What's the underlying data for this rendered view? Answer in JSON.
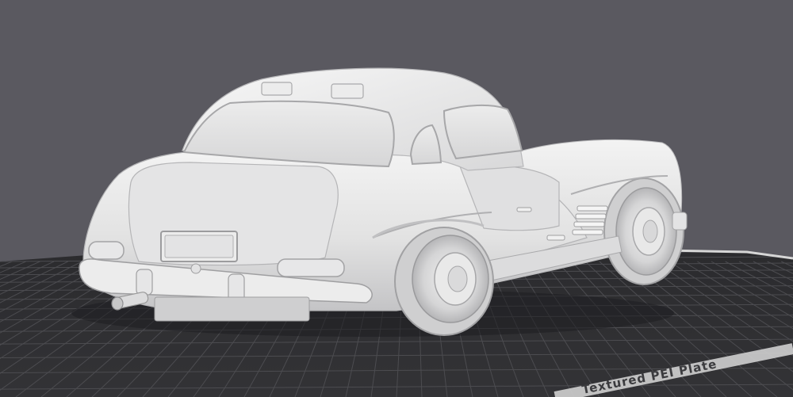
{
  "viewport": {
    "background_color": "#5a5960"
  },
  "build_plate": {
    "surface_color": "#2e2e31",
    "grid_line_color": "#4c4c50",
    "edge_color": "#d9d9d9",
    "label": "Textured PEI Plate"
  },
  "model": {
    "body_color": "#e6e6e6",
    "shadow_color": "#a9a9ab",
    "highlight_color": "#f7f7f7"
  }
}
